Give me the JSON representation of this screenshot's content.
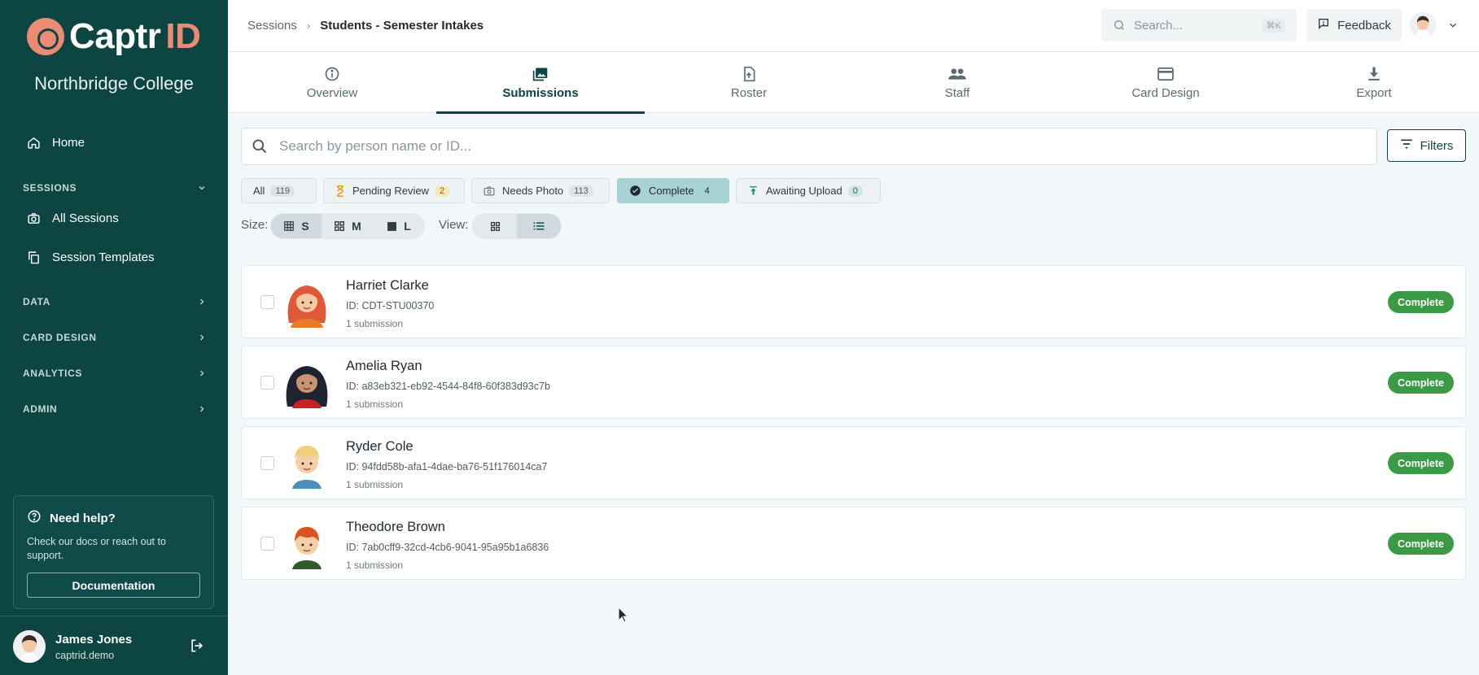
{
  "brand": {
    "name_main": "Captr",
    "name_accent": "ID",
    "accent_color": "#ec8b74",
    "sidebar_color": "#0c4542"
  },
  "sidebar": {
    "org_name": "Northbridge College",
    "home_label": "Home",
    "sessions_header": "SESSIONS",
    "sessions_items": [
      {
        "label": "All Sessions",
        "icon": "camera-icon"
      },
      {
        "label": "Session Templates",
        "icon": "copy-icon"
      }
    ],
    "sections": [
      "DATA",
      "CARD DESIGN",
      "ANALYTICS",
      "ADMIN"
    ],
    "help": {
      "title": "Need help?",
      "text": "Check our docs or reach out to support.",
      "button": "Documentation"
    },
    "user": {
      "name": "James Jones",
      "org": "captrid.demo"
    }
  },
  "topbar": {
    "breadcrumb": [
      "Sessions",
      "Students - Semester Intakes"
    ],
    "search_placeholder": "Search...",
    "search_shortcut": "⌘K",
    "feedback_label": "Feedback"
  },
  "tabs": [
    {
      "label": "Overview",
      "icon": "info-icon",
      "active": false
    },
    {
      "label": "Submissions",
      "icon": "images-icon",
      "active": true
    },
    {
      "label": "Roster",
      "icon": "file-upload-icon",
      "active": false
    },
    {
      "label": "Staff",
      "icon": "people-icon",
      "active": false
    },
    {
      "label": "Card Design",
      "icon": "credit-card-icon",
      "active": false
    },
    {
      "label": "Export",
      "icon": "download-icon",
      "active": false
    }
  ],
  "search": {
    "placeholder": "Search by person name or ID..."
  },
  "filters_label": "Filters",
  "status_chips": [
    {
      "label": "All",
      "count": "119"
    },
    {
      "label": "Pending Review",
      "count": "2"
    },
    {
      "label": "Needs Photo",
      "count": "113"
    },
    {
      "label": "Complete",
      "count": "4"
    },
    {
      "label": "Awaiting Upload",
      "count": "0"
    }
  ],
  "size": {
    "label": "Size:",
    "options": [
      "S",
      "M",
      "L"
    ],
    "selected": "S"
  },
  "view": {
    "label": "View:",
    "selected": "list"
  },
  "people": [
    {
      "name": "Harriet Clarke",
      "id": "ID: CDT-STU00370",
      "submissions": "1 submission",
      "status": "Complete"
    },
    {
      "name": "Amelia Ryan",
      "id": "ID: a83eb321-eb92-4544-84f8-60f383d93c7b",
      "submissions": "1 submission",
      "status": "Complete"
    },
    {
      "name": "Ryder Cole",
      "id": "ID: 94fdd58b-afa1-4dae-ba76-51f176014ca7",
      "submissions": "1 submission",
      "status": "Complete"
    },
    {
      "name": "Theodore Brown",
      "id": "ID: 7ab0cff9-32cd-4cb6-9041-95a95b1a6836",
      "submissions": "1 submission",
      "status": "Complete"
    }
  ]
}
